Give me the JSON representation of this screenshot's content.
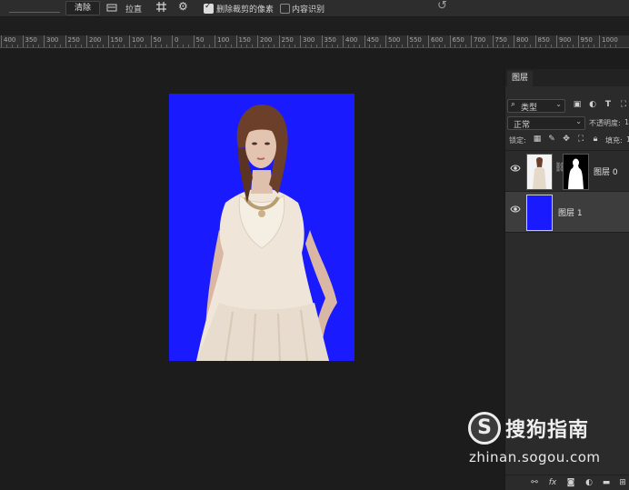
{
  "options_bar": {
    "clear_label": "清除",
    "straighten_label": "拉直",
    "delete_cropped_label": "删除裁剪的像素",
    "delete_cropped_checked": true,
    "content_aware_label": "内容识别",
    "content_aware_checked": false
  },
  "ruler": {
    "labels": [
      "400",
      "350",
      "300",
      "250",
      "200",
      "150",
      "100",
      "50",
      "0",
      "50",
      "100",
      "150",
      "200",
      "250",
      "300",
      "350",
      "400",
      "450",
      "500",
      "550",
      "600",
      "650",
      "700",
      "750",
      "800",
      "850",
      "900",
      "950",
      "1000"
    ]
  },
  "layers_panel": {
    "tab_label": "图层",
    "filter_kind": "类型",
    "filter_icons": [
      "image-filter-icon",
      "adjustment-filter-icon",
      "type-filter-icon",
      "shape-filter-icon"
    ],
    "blend_mode": "正常",
    "opacity_label": "不透明度:",
    "opacity_value": "1",
    "lock_label": "锁定:",
    "lock_icons": [
      "lock-transparent-icon",
      "lock-image-icon",
      "lock-position-icon",
      "lock-artboard-icon",
      "lock-all-icon"
    ],
    "fill_label": "填充:",
    "fill_value": "1",
    "layers": [
      {
        "name": "图层 0",
        "visible": true,
        "has_mask": true,
        "selected": false
      },
      {
        "name": "图层 1",
        "visible": true,
        "has_mask": false,
        "selected": true,
        "thumb_color": "#1a1aff"
      }
    ],
    "bottom_icons": [
      "link-icon",
      "fx-icon",
      "mask-icon",
      "adjustment-icon",
      "folder-icon",
      "new-layer-icon"
    ]
  },
  "canvas": {
    "background_color": "#1a1aff"
  },
  "watermark": {
    "logo_letter": "S",
    "title": "搜狗指南",
    "url": "zhinan.sogou.com"
  }
}
